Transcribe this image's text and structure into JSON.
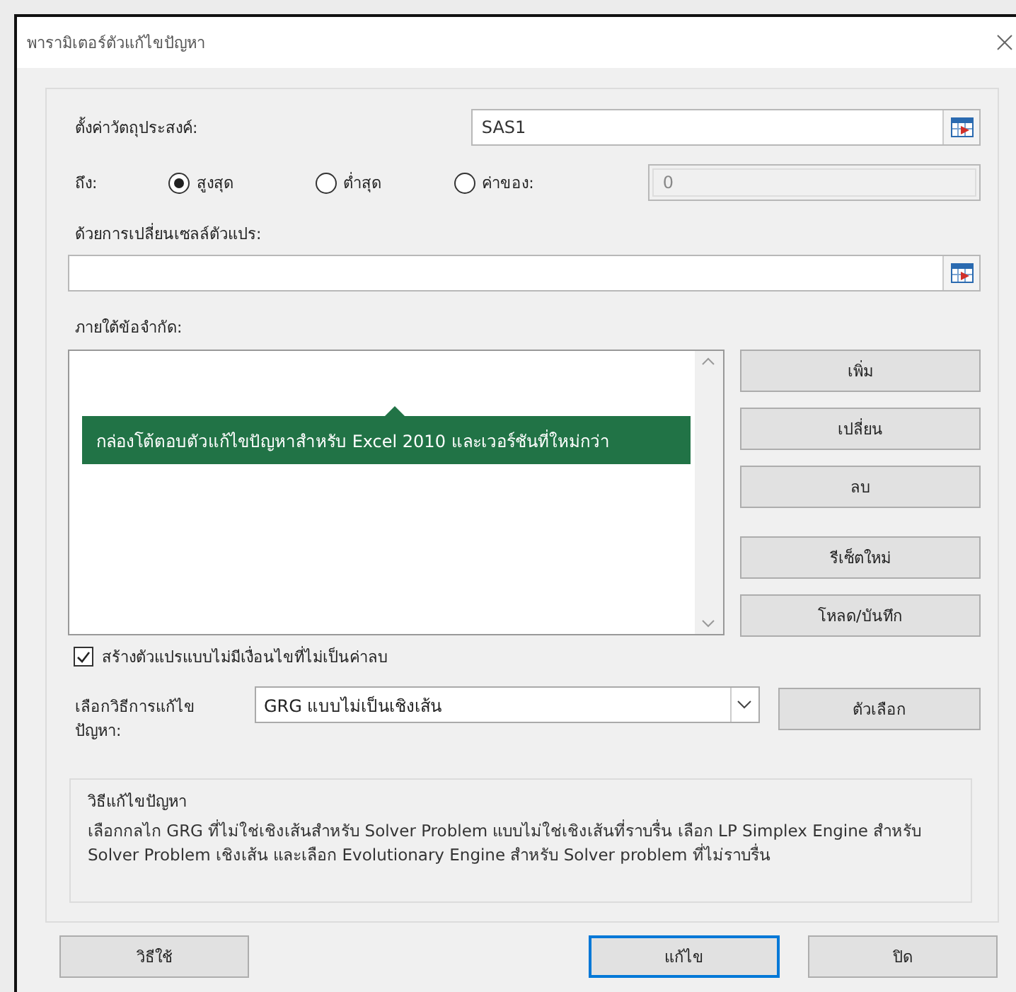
{
  "window": {
    "title": "พารามิเตอร์ตัวแก้ไขปัญหา"
  },
  "objective": {
    "label": "ตั้งค่าวัตถุประสงค์:",
    "value": "SAS1"
  },
  "to": {
    "label": "ถึง:",
    "options": [
      {
        "label": "สูงสุด",
        "selected": true
      },
      {
        "label": "ต่ำสุด",
        "selected": false
      },
      {
        "label": "ค่าของ:",
        "selected": false
      }
    ],
    "value_of": "0"
  },
  "changing_cells": {
    "label": "ด้วยการเปลี่ยนเซลล์ตัวแปร:"
  },
  "constraints": {
    "label": "ภายใต้ข้อจำกัด:",
    "buttons": [
      "เพิ่ม",
      "เปลี่ยน",
      "ลบ",
      "รีเซ็ตใหม่",
      "โหลด/บันทึก"
    ]
  },
  "tooltip": "กล่องโต้ตอบตัวแก้ไขปัญหาสำหรับ Excel 2010 และเวอร์ชันที่ใหม่กว่า",
  "nonnegative": {
    "label": "สร้างตัวแปรแบบไม่มีเงื่อนไขที่ไม่เป็นค่าลบ",
    "checked": true
  },
  "method": {
    "label": "เลือกวิธีการแก้ไขปัญหา:",
    "value": "GRG แบบไม่เป็นเชิงเส้น",
    "options_button": "ตัวเลือก"
  },
  "description": {
    "title": "วิธีแก้ไขปัญหา",
    "text": "เลือกกลไก GRG ที่ไม่ใช่เชิงเส้นสำหรับ Solver Problem แบบไม่ใช่เชิงเส้นที่ราบรื่น เลือก LP Simplex Engine สำหรับ Solver Problem เชิงเส้น และเลือก Evolutionary Engine สำหรับ Solver problem ที่ไม่ราบรื่น"
  },
  "footer_buttons": [
    {
      "label": "วิธีใช้",
      "default": false
    },
    {
      "label": "แก้ไข",
      "default": true
    },
    {
      "label": "ปิด",
      "default": false
    }
  ]
}
